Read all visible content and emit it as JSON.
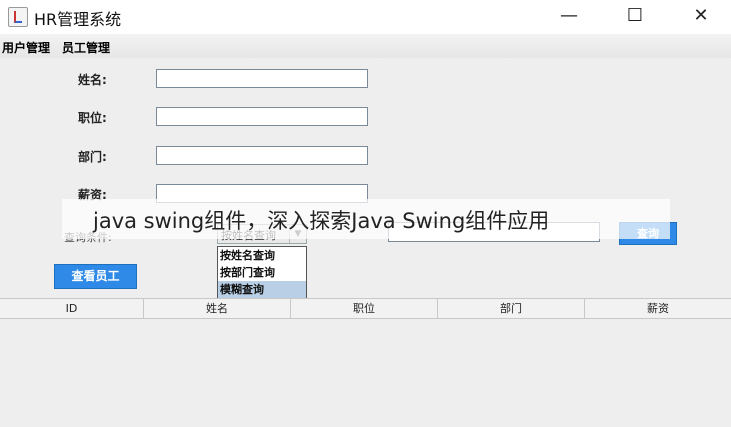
{
  "window": {
    "title": "HR管理系统",
    "minimize": "—",
    "maximize": "☐",
    "close": "✕"
  },
  "menubar": {
    "items": [
      "用户管理",
      "员工管理"
    ]
  },
  "form": {
    "name_label": "姓名:",
    "position_label": "职位:",
    "department_label": "部门:",
    "salary_label": "薪资:"
  },
  "query": {
    "label": "查询条件:",
    "selected": "按姓名查询",
    "options": [
      "按姓名查询",
      "按部门查询",
      "模糊查询"
    ],
    "highlighted": "模糊查询",
    "button": "查询"
  },
  "view_button": "查看员工",
  "table": {
    "columns": [
      "ID",
      "姓名",
      "职位",
      "部门",
      "薪资"
    ]
  },
  "watermark": "java swing组件，深入探索Java Swing组件应用",
  "colors": {
    "button": "#2e8ae6",
    "selection": "#b8cfe5"
  }
}
